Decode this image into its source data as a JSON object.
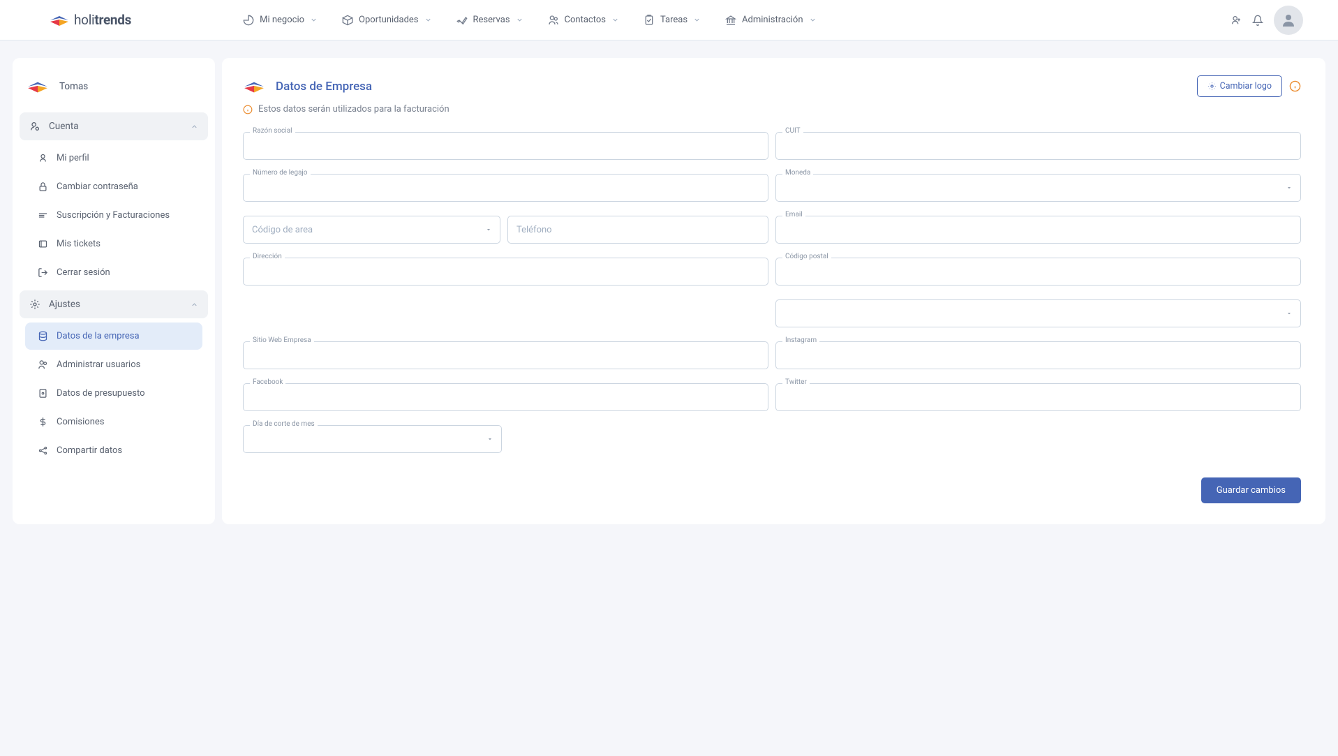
{
  "logo": {
    "light": "holi",
    "bold": "trends"
  },
  "nav": {
    "items": [
      {
        "label": "Mi negocio"
      },
      {
        "label": "Oportunidades"
      },
      {
        "label": "Reservas"
      },
      {
        "label": "Contactos"
      },
      {
        "label": "Tareas"
      },
      {
        "label": "Administración"
      }
    ]
  },
  "sidebar": {
    "username": "Tomas",
    "sections": {
      "cuenta": {
        "label": "Cuenta"
      },
      "ajustes": {
        "label": "Ajustes"
      }
    },
    "items": {
      "perfil": "Mi perfil",
      "password": "Cambiar contraseña",
      "suscripcion": "Suscripción y Facturaciones",
      "tickets": "Mis tickets",
      "cerrar": "Cerrar sesión",
      "empresa": "Datos de la empresa",
      "usuarios": "Administrar usuarios",
      "presupuesto": "Datos de presupuesto",
      "comisiones": "Comisiones",
      "compartir": "Compartir datos"
    }
  },
  "main": {
    "title": "Datos de Empresa",
    "change_logo_btn": "Cambiar logo",
    "info_text": "Estos datos serán utilizados para la facturación",
    "fields": {
      "razon_social": "Razón social",
      "cuit": "CUIT",
      "numero_legajo": "Número de legajo",
      "moneda": "Moneda",
      "codigo_area": "Código de area",
      "telefono": "Teléfono",
      "email": "Email",
      "direccion": "Dirección",
      "codigo_postal": "Código postal",
      "sitio_web": "Sitio Web Empresa",
      "instagram": "Instagram",
      "facebook": "Facebook",
      "twitter": "Twitter",
      "dia_corte": "Día de corte de mes"
    },
    "save_btn": "Guardar cambios"
  }
}
